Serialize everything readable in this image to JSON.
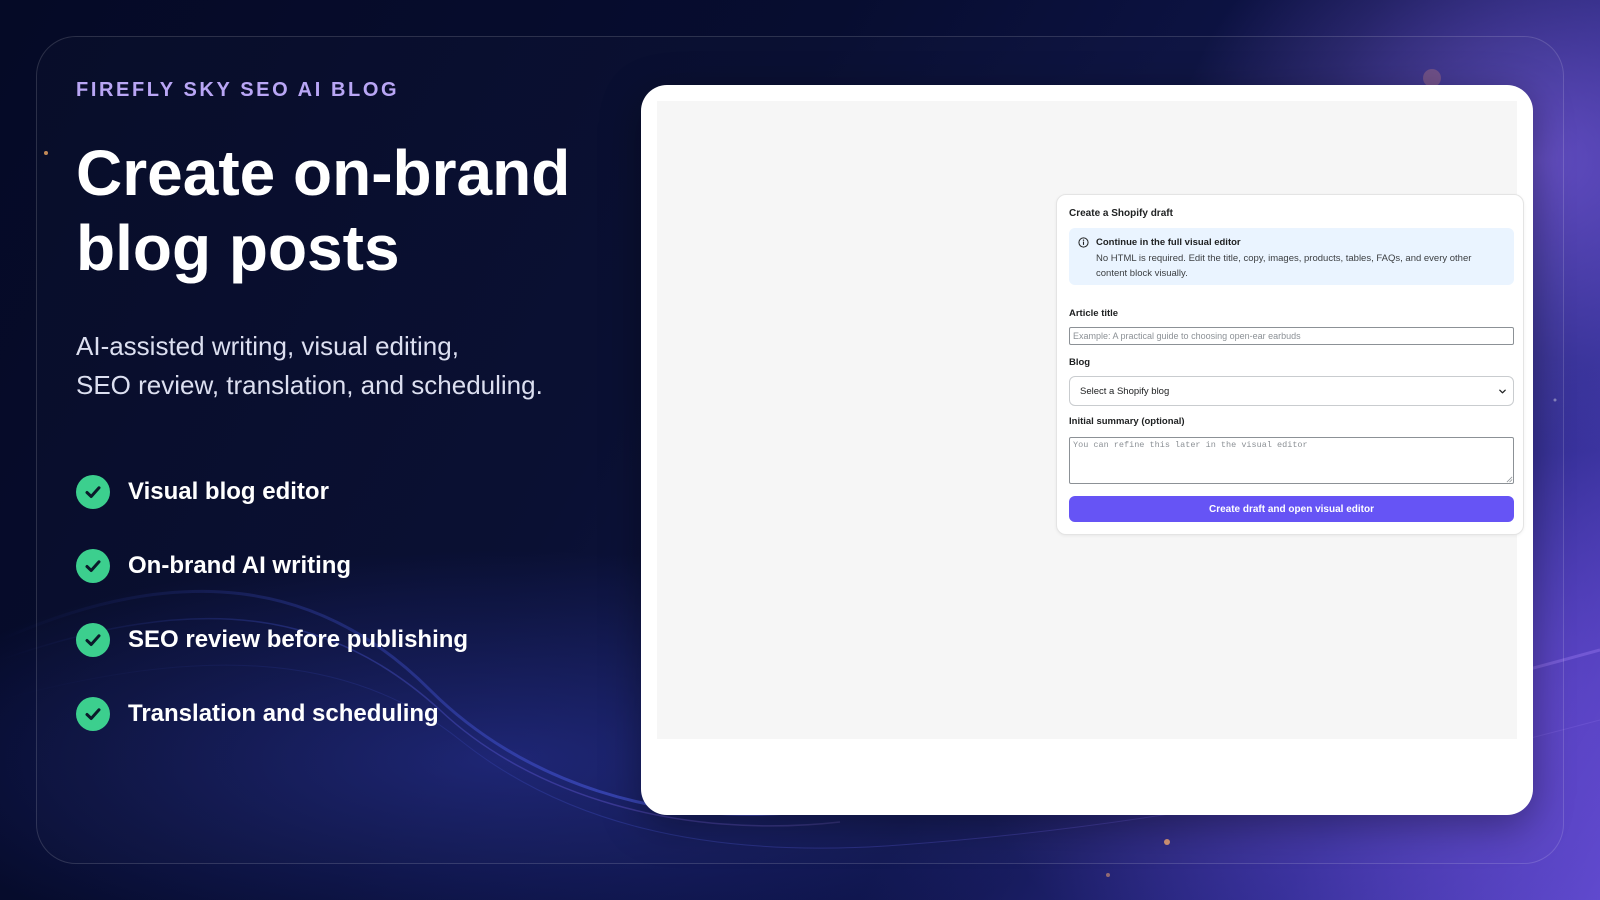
{
  "brand": {
    "eyebrow": "FIREFLY SKY SEO AI BLOG",
    "accent_color": "#b9a6f5"
  },
  "hero": {
    "headline": "Create on-brand blog posts",
    "subhead_lines": [
      "AI-assisted writing, visual editing,",
      "SEO review, translation, and scheduling."
    ]
  },
  "features": {
    "icon": "check-circle-icon",
    "icon_color": "#3ccf8e",
    "items": [
      {
        "label": "Visual blog editor"
      },
      {
        "label": "On-brand AI writing"
      },
      {
        "label": "SEO review before publishing"
      },
      {
        "label": "Translation and scheduling"
      }
    ]
  },
  "draft_form": {
    "title": "Create a Shopify draft",
    "banner": {
      "icon": "info-icon",
      "title": "Continue in the full visual editor",
      "body": "No HTML is required. Edit the title, copy, images, products, tables, FAQs, and every other content block visually."
    },
    "article_title": {
      "label": "Article title",
      "value": "",
      "placeholder": "Example: A practical guide to choosing open-ear earbuds"
    },
    "blog": {
      "label": "Blog",
      "selected": "Select a Shopify blog"
    },
    "summary": {
      "label": "Initial summary (optional)",
      "value": "",
      "placeholder": "You can refine this later in the visual editor"
    },
    "submit_label": "Create draft and open visual editor",
    "button_color": "#6654f5"
  }
}
